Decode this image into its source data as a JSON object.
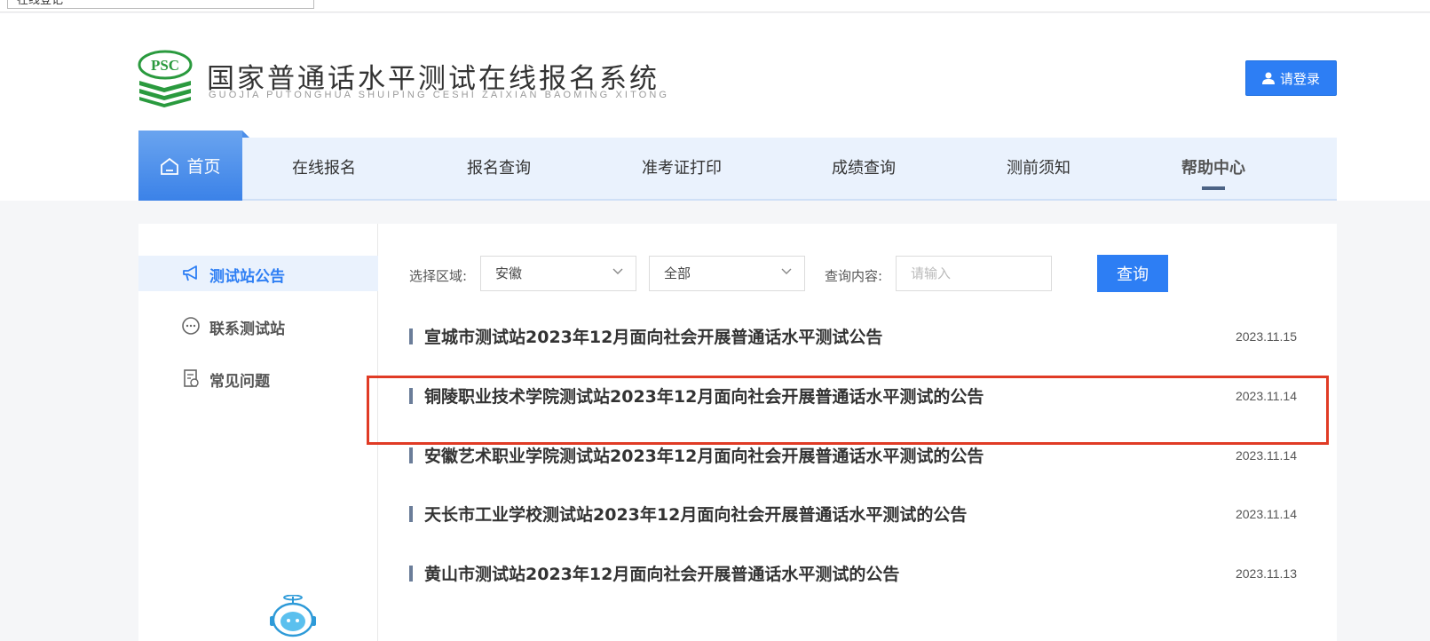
{
  "browser": {
    "address_text": "在线登记"
  },
  "header": {
    "logo_badge": "PSC",
    "title_cn": "国家普通话水平测试在线报名系统",
    "title_en": "GUOJIA PUTONGHUA SHUIPING CESHI ZAIXIAN BAOMING XITONG",
    "login_label": "请登录"
  },
  "nav": {
    "home": "首页",
    "items": [
      "在线报名",
      "报名查询",
      "准考证打印",
      "成绩查询",
      "测前须知",
      "帮助中心"
    ],
    "active_item": "帮助中心"
  },
  "sidebar": {
    "items": [
      {
        "label": "测试站公告",
        "icon": "megaphone-icon",
        "active": true
      },
      {
        "label": "联系测试站",
        "icon": "chat-bubble-icon",
        "active": false
      },
      {
        "label": "常见问题",
        "icon": "document-question-icon",
        "active": false
      }
    ]
  },
  "filter": {
    "region_label": "选择区域:",
    "region_value": "安徽",
    "city_value": "全部",
    "query_label": "查询内容:",
    "query_placeholder": "请输入",
    "query_button": "查询"
  },
  "announcements": [
    {
      "title": "宣城市测试站2023年12月面向社会开展普通话水平测试公告",
      "date": "2023.11.15"
    },
    {
      "title": "铜陵职业技术学院测试站2023年12月面向社会开展普通话水平测试的公告",
      "date": "2023.11.14",
      "highlighted": true
    },
    {
      "title": "安徽艺术职业学院测试站2023年12月面向社会开展普通话水平测试的公告",
      "date": "2023.11.14"
    },
    {
      "title": "天长市工业学校测试站2023年12月面向社会开展普通话水平测试的公告",
      "date": "2023.11.14"
    },
    {
      "title": "黄山市测试站2023年12月面向社会开展普通话水平测试的公告",
      "date": "2023.11.13"
    }
  ],
  "colors": {
    "accent": "#2d7ef4",
    "highlight_border": "#e03b25",
    "logo_green": "#2a9a3e"
  }
}
